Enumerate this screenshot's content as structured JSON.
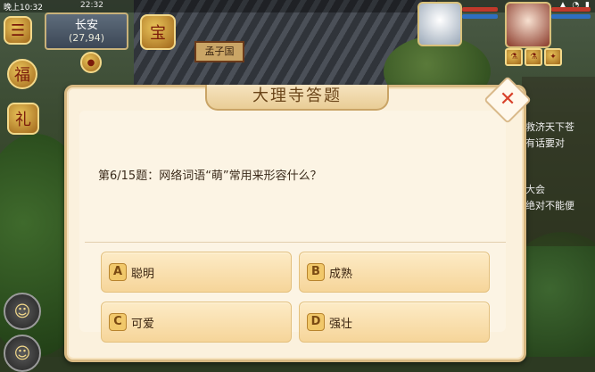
{
  "status": {
    "clock": "晚上10:32",
    "game_time": "22:32"
  },
  "location": {
    "name": "长安",
    "coord": "(27,94)"
  },
  "background": {
    "plaque": "孟子国"
  },
  "side_chat": {
    "lines": [
      "救济天下苍",
      "有话要对",
      "大会",
      "绝对不能便"
    ]
  },
  "dialog": {
    "title": "大理寺答题",
    "question": "第6/15题：网络词语“萌”常用来形容什么？",
    "options": [
      {
        "letter": "A",
        "text": "聪明"
      },
      {
        "letter": "B",
        "text": "成熟"
      },
      {
        "letter": "C",
        "text": "可爱"
      },
      {
        "letter": "D",
        "text": "强壮"
      }
    ]
  },
  "icons": {
    "close": "close-icon",
    "hud": [
      "event-icon",
      "gift-icon",
      "pet-icon",
      "character-avatar"
    ]
  },
  "colors": {
    "accent": "#d8412a",
    "panel": "#fbf1dd",
    "option": "#f6d59a"
  }
}
